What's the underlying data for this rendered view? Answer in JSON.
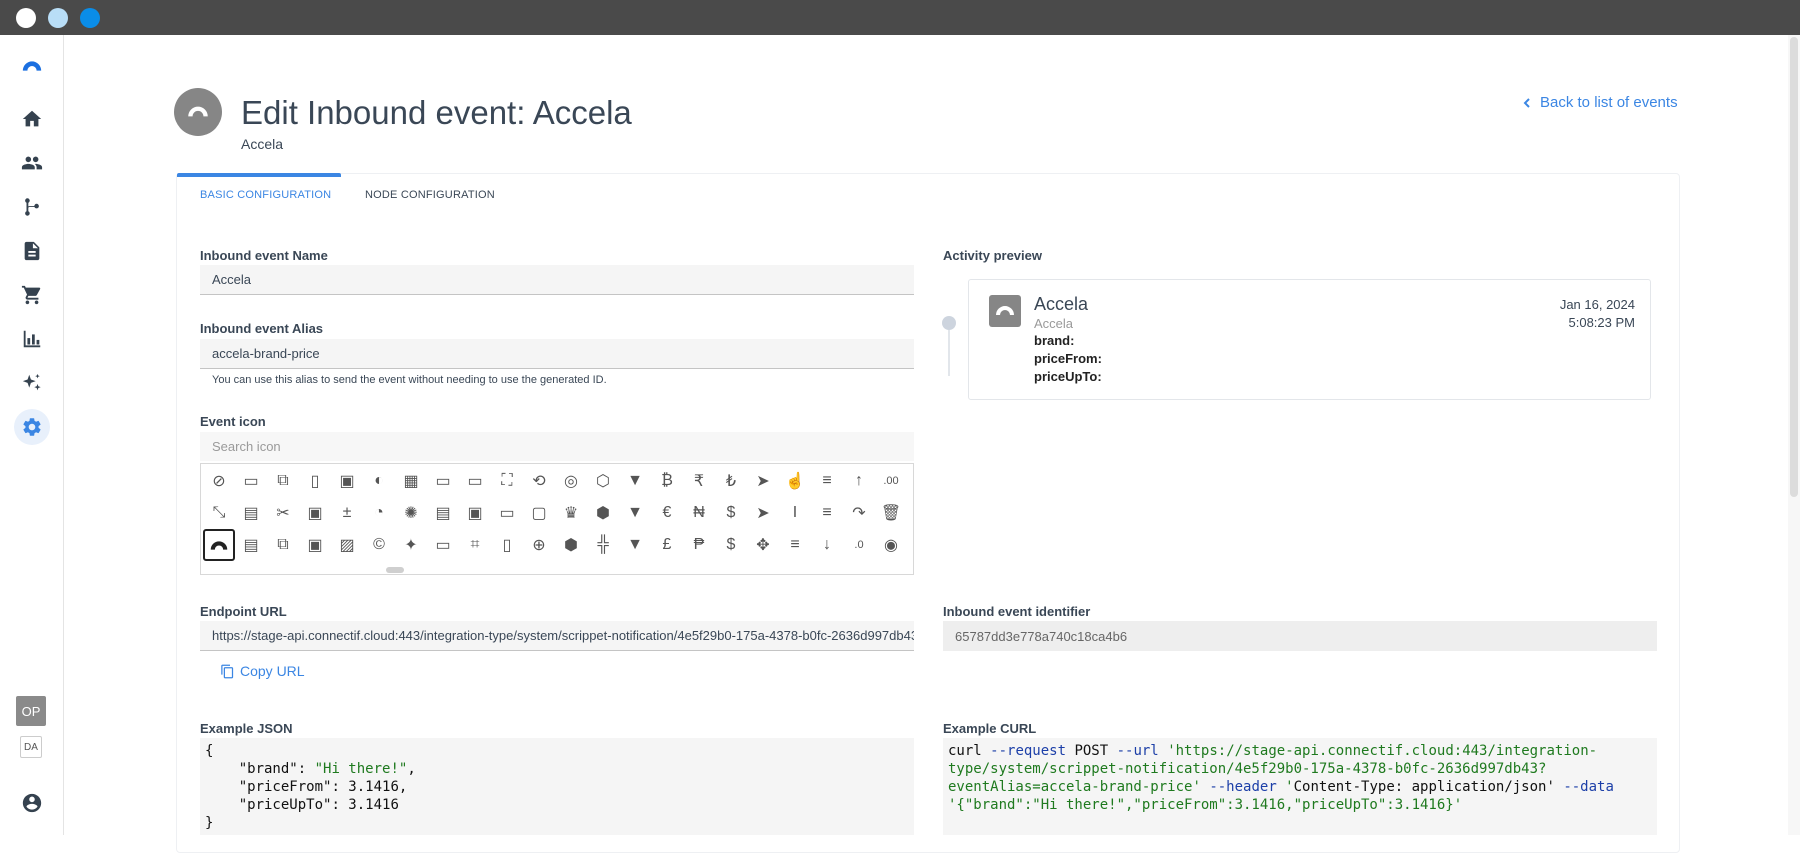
{
  "window": {
    "dots": [
      "#ffffff",
      "#b9def7",
      "#0a8de8"
    ]
  },
  "nav": {
    "items": [
      {
        "name": "home-icon",
        "active": false
      },
      {
        "name": "people-icon",
        "active": false
      },
      {
        "name": "flow-icon",
        "active": false
      },
      {
        "name": "document-icon",
        "active": false
      },
      {
        "name": "cart-icon",
        "active": false
      },
      {
        "name": "chart-icon",
        "active": false
      },
      {
        "name": "sparkle-icon",
        "active": false
      },
      {
        "name": "gear-icon",
        "active": true
      }
    ],
    "account_badges": [
      "OP",
      "DA"
    ],
    "user_icon": "user-circle-icon"
  },
  "header": {
    "title": "Edit Inbound event: Accela",
    "subtitle": "Accela",
    "back_link": "Back to list of events"
  },
  "tabs": [
    {
      "label": "BASIC CONFIGURATION",
      "active": true
    },
    {
      "label": "NODE CONFIGURATION",
      "active": false
    }
  ],
  "form": {
    "name_label": "Inbound event Name",
    "name_value": "Accela",
    "alias_label": "Inbound event Alias",
    "alias_value": "accela-brand-price",
    "alias_hint": "You can use this alias to send the event without needing to use the generated ID.",
    "icon_label": "Event icon",
    "icon_search_placeholder": "Search icon",
    "endpoint_label": "Endpoint URL",
    "endpoint_value": "https://stage-api.connectif.cloud:443/integration-type/system/scrippet-notification/4e5f29b0-175a-4378-b0fc-2636d997db43",
    "copy_label": "Copy URL",
    "identifier_label": "Inbound event identifier",
    "identifier_value": "65787dd3e778a740c18ca4b6",
    "json_label": "Example JSON",
    "curl_label": "Example CURL"
  },
  "icon_rows": [
    [
      "compass-icon",
      "terminal-icon",
      "copy-icon",
      "clipboard-icon",
      "save-dots-icon",
      "palette-icon",
      "calculator-icon",
      "credit-card-icon",
      "card-add-icon",
      "fullscreen-icon",
      "rotate-crop-icon",
      "target-icon",
      "cube-icon",
      "cup-icon",
      "bitcoin-icon",
      "rupee-icon",
      "lira-icon",
      "cursor-icon",
      "hand-pointer-icon",
      "database-minus-icon",
      "arrow-up-icon",
      "decimal-icon"
    ],
    [
      "resize-icon",
      "contact-card-icon",
      "scissors-icon",
      "floppy-icon",
      "plus-minus-icon",
      "cookie-icon",
      "bug-icon",
      "cards-stack-icon",
      "frame-icon",
      "rectangle-icon",
      "square-icon",
      "crown-icon",
      "cubes-icon",
      "cup-off-icon",
      "euro-icon",
      "naira-icon",
      "dollar-icon",
      "cursor-outline-icon",
      "text-cursor-icon",
      "database-plus-icon",
      "redo-icon",
      "trash-icon"
    ],
    [
      "rainbow-icon",
      "contact-box-icon",
      "copy-outline-icon",
      "floppy-multiple-icon",
      "image-edit-icon",
      "copyright-icon",
      "sparkles-icon",
      "card-off-icon",
      "crop-icon",
      "phone-icon",
      "crosshair-icon",
      "cube-solid-icon",
      "blocks-icon",
      "basket-icon",
      "pound-icon",
      "peso-icon",
      "dollar-off-icon",
      "move-icon",
      "database-icon",
      "arrow-down-icon",
      "decimal-decrease-icon",
      "coin-icon"
    ]
  ],
  "icon_glyphs": [
    [
      "⊘",
      "▭",
      "⧉",
      "▯",
      "▣",
      "◐",
      "▦",
      "▭",
      "▭",
      "⛶",
      "⟲",
      "◎",
      "⬡",
      "▼",
      "₿",
      "₹",
      "₺",
      "➤",
      "☝",
      "≡",
      "↑",
      ".00"
    ],
    [
      "⤡",
      "▤",
      "✂",
      "▣",
      "±",
      "◔",
      "✺",
      "▤",
      "▣",
      "▭",
      "▢",
      "♛",
      "⬢",
      "▼",
      "€",
      "₦",
      "$",
      "➤",
      "Ι",
      "≡",
      "↷",
      "🗑"
    ],
    [
      "◠",
      "▤",
      "⧉",
      "▣",
      "▨",
      "©",
      "✦",
      "▭",
      "⌗",
      "▯",
      "⊕",
      "⬢",
      "╬",
      "▼",
      "£",
      "₱",
      "$",
      "✥",
      "≡",
      "↓",
      ".0",
      "◉"
    ]
  ],
  "selected_icon": {
    "row": 2,
    "col": 0
  },
  "preview": {
    "heading": "Activity preview",
    "name": "Accela",
    "sub": "Accela",
    "fields": [
      "brand:",
      "priceFrom:",
      "priceUpTo:"
    ],
    "date": "Jan 16, 2024",
    "time": "5:08:23 PM"
  },
  "example_json": {
    "lines": [
      "{",
      "    \"brand\": \"Hi there!\",",
      "    \"priceFrom\": 3.1416,",
      "    \"priceUpTo\": 3.1416",
      "}"
    ]
  },
  "example_curl": {
    "lines": [
      "curl --request POST --url 'https://stage-api.connectif.cloud:443/integration-",
      "type/system/scrippet-notification/4e5f29b0-175a-4378-b0fc-2636d997db43?",
      "eventAlias=accela-brand-price' --header 'Content-Type: application/json' --data",
      "'{\"brand\":\"Hi there!\",\"priceFrom\":3.1416,\"priceUpTo\":3.1416}'"
    ]
  },
  "colors": {
    "accent": "#3b86e3",
    "titlebar": "#4a4a4a",
    "logo_grey": "#868686"
  }
}
